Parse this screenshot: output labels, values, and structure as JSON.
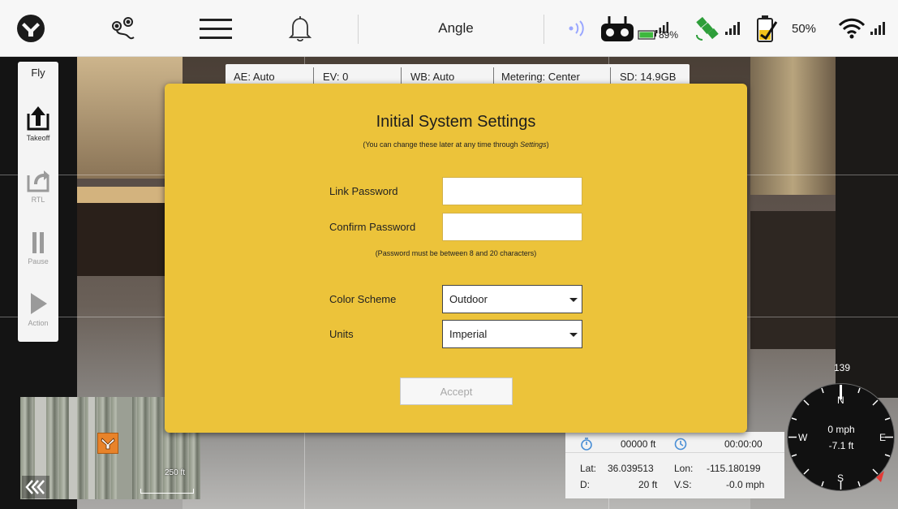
{
  "topbar": {
    "mode": "Angle",
    "controller_battery": "89%",
    "drone_battery": "50%"
  },
  "flight_panel": {
    "title": "Fly",
    "takeoff": "Takeoff",
    "rtl": "RTL",
    "pause": "Pause",
    "action": "Action"
  },
  "camera_settings": {
    "ae": "AE:  Auto",
    "ev": "EV:  0",
    "wb": "WB:  Auto",
    "metering": "Metering:  Center",
    "sd": "SD:  14.9GB"
  },
  "dialog": {
    "title": "Initial System Settings",
    "subtitle_prefix": "(You can change these later at any time through ",
    "subtitle_link": "Settings",
    "subtitle_suffix": ")",
    "link_password_label": "Link Password",
    "link_password_value": "",
    "confirm_password_label": "Confirm Password",
    "confirm_password_value": "",
    "password_hint": "(Password must be between 8 and 20 characters)",
    "color_scheme_label": "Color Scheme",
    "color_scheme_value": "Outdoor",
    "units_label": "Units",
    "units_value": "Imperial",
    "accept_label": "Accept"
  },
  "minimap": {
    "scale": "250 ft"
  },
  "telemetry": {
    "distance": "00000 ft",
    "flight_time": "00:00:00",
    "lat_label": "Lat:",
    "lat_value": "36.039513",
    "lon_label": "Lon:",
    "lon_value": "-115.180199",
    "d_label": "D:",
    "d_value": "20 ft",
    "vs_label": "V.S:",
    "vs_value": "-0.0 mph"
  },
  "compass": {
    "heading": "139",
    "n": "N",
    "e": "E",
    "s": "S",
    "w": "W",
    "speed": "0 mph",
    "altitude": "-7.1 ft"
  },
  "colors": {
    "dialog_bg": "#ecc33a",
    "topbar_bg": "#f7f7f7",
    "battery_green": "#3db83d",
    "gps_green": "#2e9e3a",
    "compass_red": "#e53935"
  }
}
